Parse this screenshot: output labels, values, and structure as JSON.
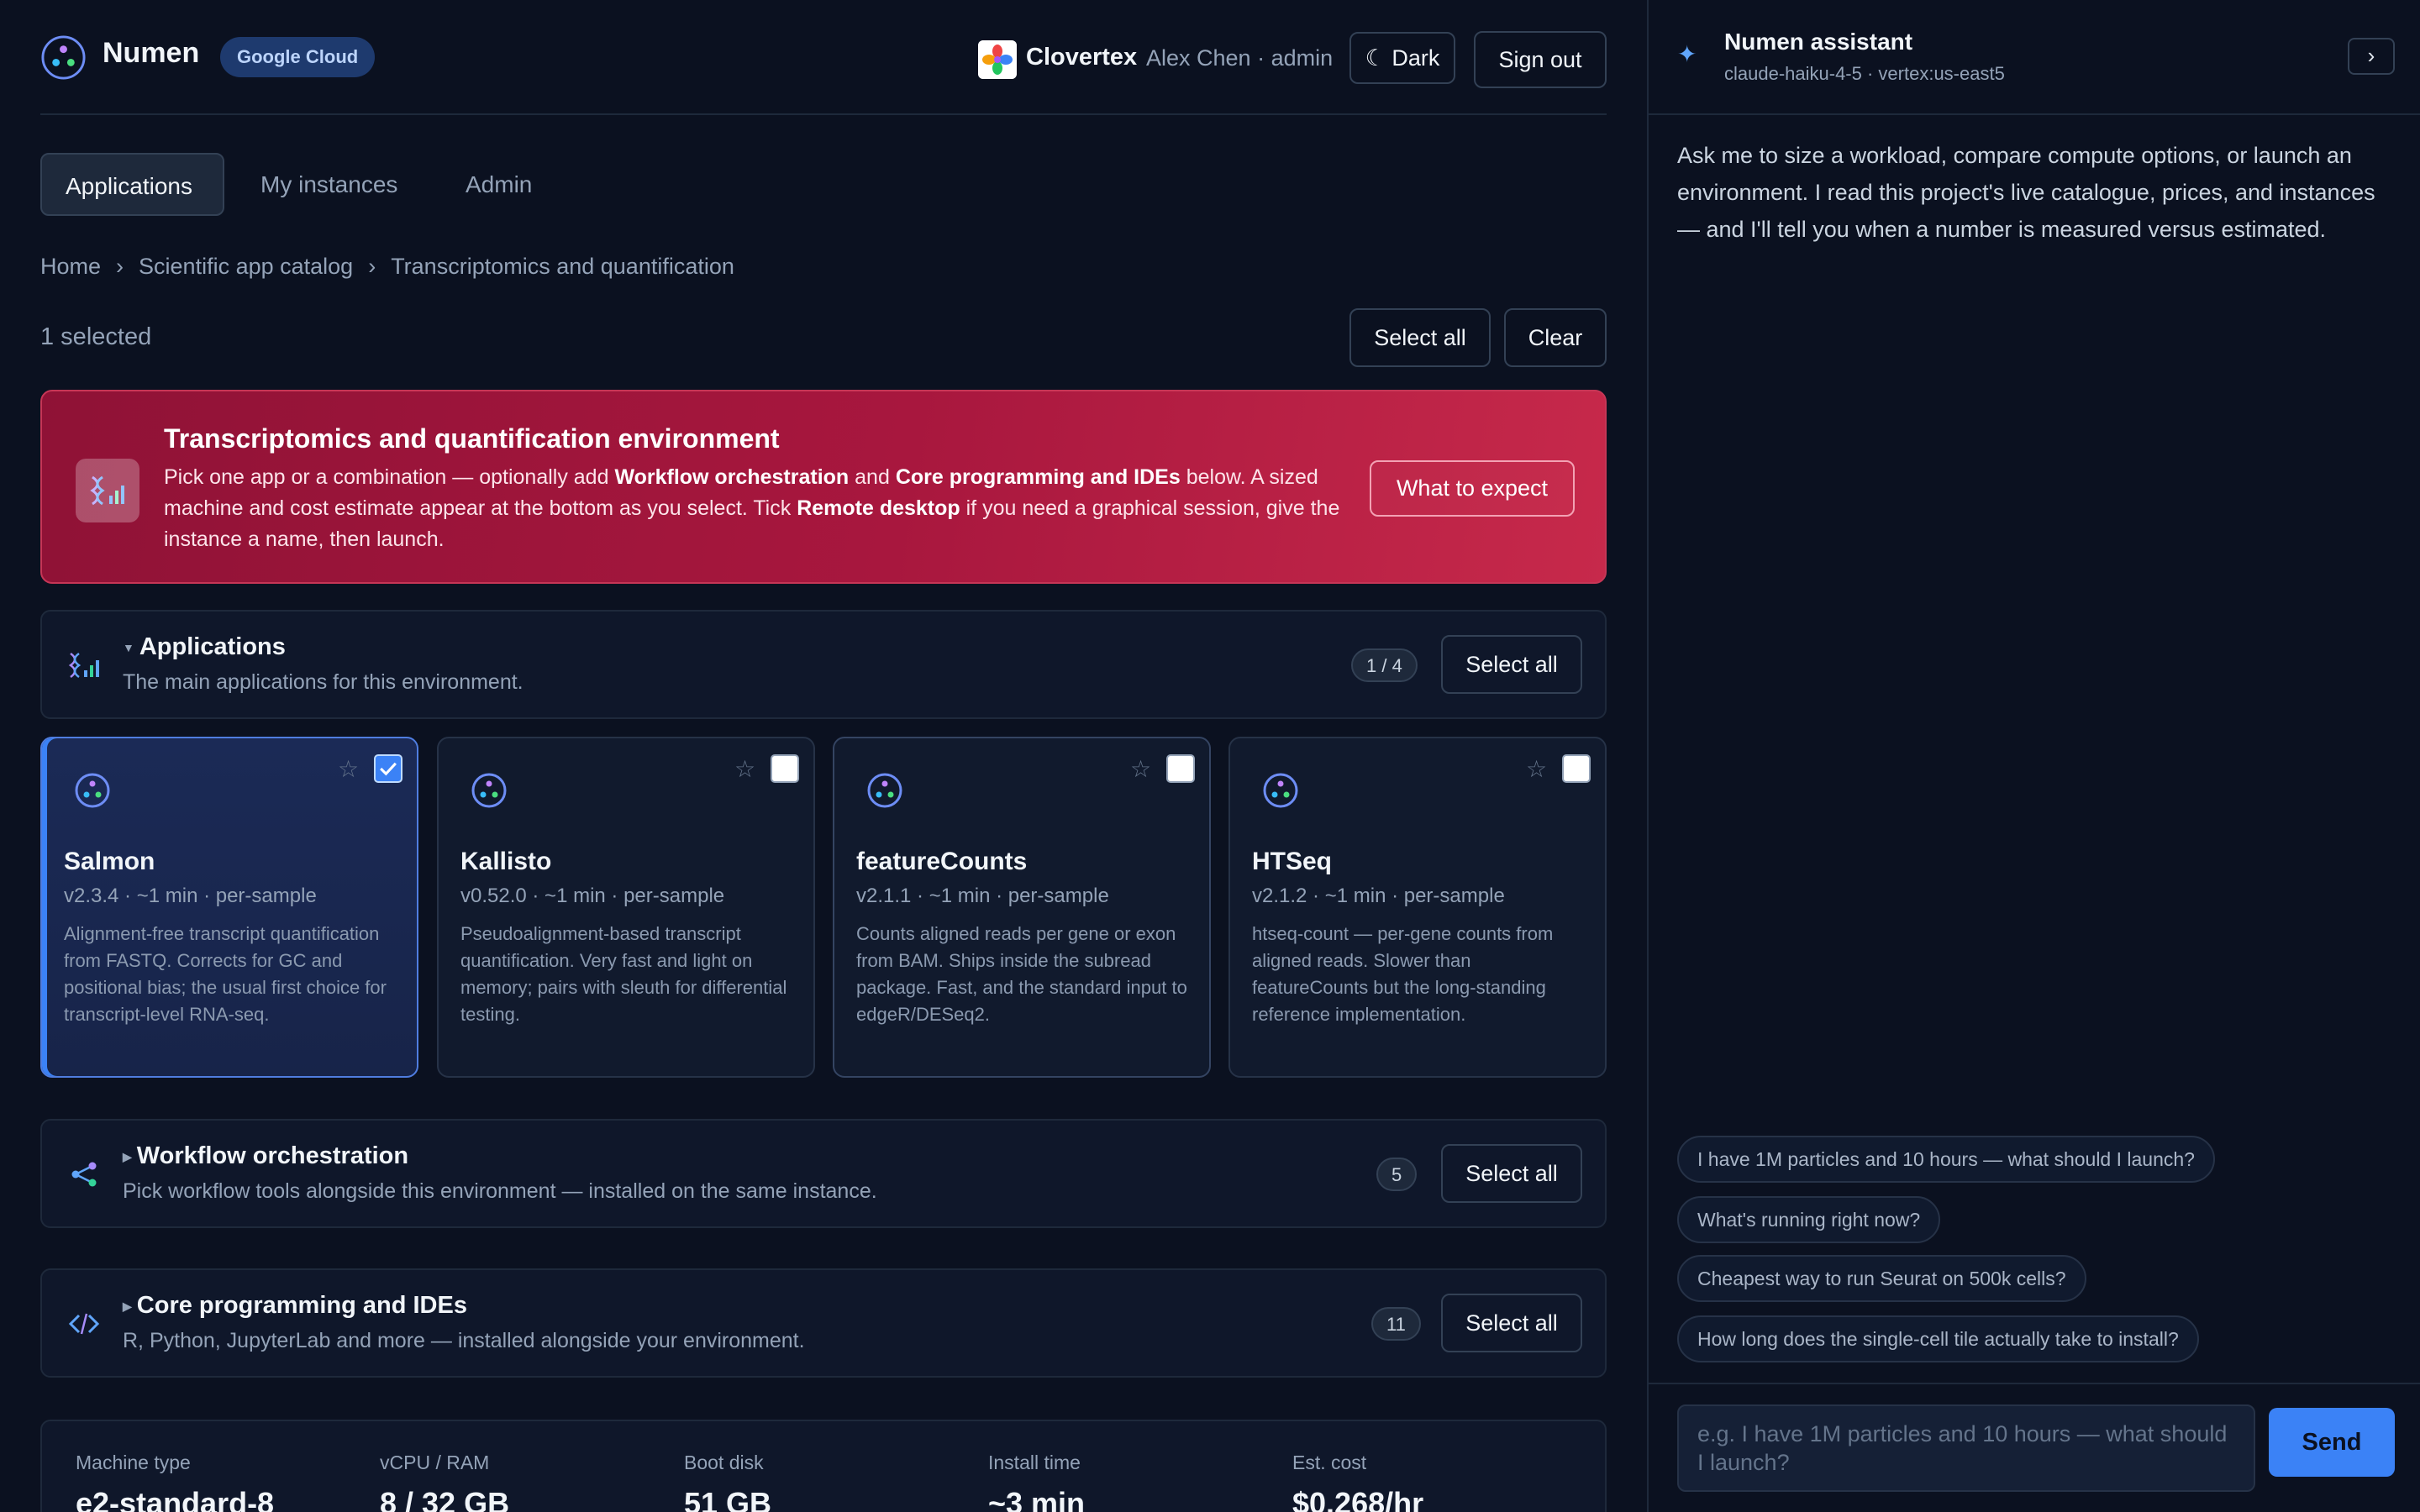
{
  "header": {
    "brand": "Numen",
    "cloud_badge": "Google Cloud",
    "org_name": "Clovertex",
    "user": "Alex Chen · admin",
    "theme_label": "☾ Dark",
    "sign_out_label": "Sign out"
  },
  "tabs": [
    {
      "label": "Applications",
      "active": true
    },
    {
      "label": "My instances",
      "active": false
    },
    {
      "label": "Admin",
      "active": false
    }
  ],
  "breadcrumb": [
    "Home",
    "Scientific app catalog",
    "Transcriptomics and quantification"
  ],
  "selection": {
    "count_text": "1 selected",
    "select_all_label": "Select all",
    "clear_label": "Clear"
  },
  "banner": {
    "title": "Transcriptomics and quantification environment",
    "text_1": "Pick one app or a combination — optionally add ",
    "bold_1": "Workflow orchestration",
    "text_2": " and ",
    "bold_2": "Core programming and IDEs",
    "text_3": " below. A sized machine and cost estimate appear at the bottom as you select. Tick ",
    "bold_3": "Remote desktop",
    "text_4": " if you need a graphical session, give the instance a name, then launch.",
    "button_label": "What to expect"
  },
  "sections": {
    "applications": {
      "title": "Applications",
      "subtitle": "The main applications for this environment.",
      "count": "1 / 4",
      "select_all_label": "Select all"
    },
    "workflow": {
      "title": "Workflow orchestration",
      "subtitle": "Pick workflow tools alongside this environment — installed on the same instance.",
      "count": "5",
      "select_all_label": "Select all"
    },
    "core": {
      "title": "Core programming and IDEs",
      "subtitle": "R, Python, JupyterLab and more — installed alongside your environment.",
      "count": "11",
      "select_all_label": "Select all"
    }
  },
  "apps": [
    {
      "name": "Salmon",
      "meta": "v2.3.4 · ~1 min · per-sample",
      "description": "Alignment-free transcript quantification from FASTQ. Corrects for GC and positional bias; the usual first choice for transcript-level RNA-seq.",
      "selected": true,
      "icon": "app-logo-icon",
      "star": "☆"
    },
    {
      "name": "Kallisto",
      "meta": "v0.52.0 · ~1 min · per-sample",
      "description": "Pseudoalignment-based transcript quantification. Very fast and light on memory; pairs with sleuth for differential testing.",
      "selected": false,
      "icon": "app-logo-icon",
      "star": "☆"
    },
    {
      "name": "featureCounts",
      "meta": "v2.1.1 · ~1 min · per-sample",
      "description": "Counts aligned reads per gene or exon from BAM. Ships inside the subread package. Fast, and the standard input to edgeR/DESeq2.",
      "selected": false,
      "icon": "app-logo-icon",
      "star": "☆"
    },
    {
      "name": "HTSeq",
      "meta": "v2.1.2 · ~1 min · per-sample",
      "description": "htseq-count — per-gene counts from aligned reads. Slower than featureCounts but the long-standing reference implementation.",
      "selected": false,
      "icon": "app-logo-icon",
      "star": "☆"
    }
  ],
  "stats": [
    {
      "label": "Machine type",
      "value": "e2-standard-8"
    },
    {
      "label": "vCPU / RAM",
      "value": "8 / 32 GB"
    },
    {
      "label": "Boot disk",
      "value": "51 GB"
    },
    {
      "label": "Install time",
      "value": "~3 min"
    },
    {
      "label": "Est. cost",
      "value": "$0.268/hr"
    }
  ],
  "assistant": {
    "title": "Numen assistant",
    "model": "claude-haiku-4-5 · vertex:us-east5",
    "collapse_label": "›",
    "intro": "Ask me to size a workload, compare compute options, or launch an environment. I read this project's live catalogue, prices, and instances — and I'll tell you when a number is measured versus estimated.",
    "suggestions": [
      "I have 1M particles and 10 hours — what should I launch?",
      "What's running right now?",
      "Cheapest way to run Seurat on 500k cells?",
      "How long does the single-cell tile actually take to install?"
    ],
    "input_placeholder": "e.g. I have 1M particles and 10 hours — what should I launch?",
    "send_label": "Send"
  },
  "colors": {
    "background": "#0b1120",
    "accent": "#3b82f6",
    "banner": "#a8173e",
    "brand_badge": "#1e3a6e"
  }
}
